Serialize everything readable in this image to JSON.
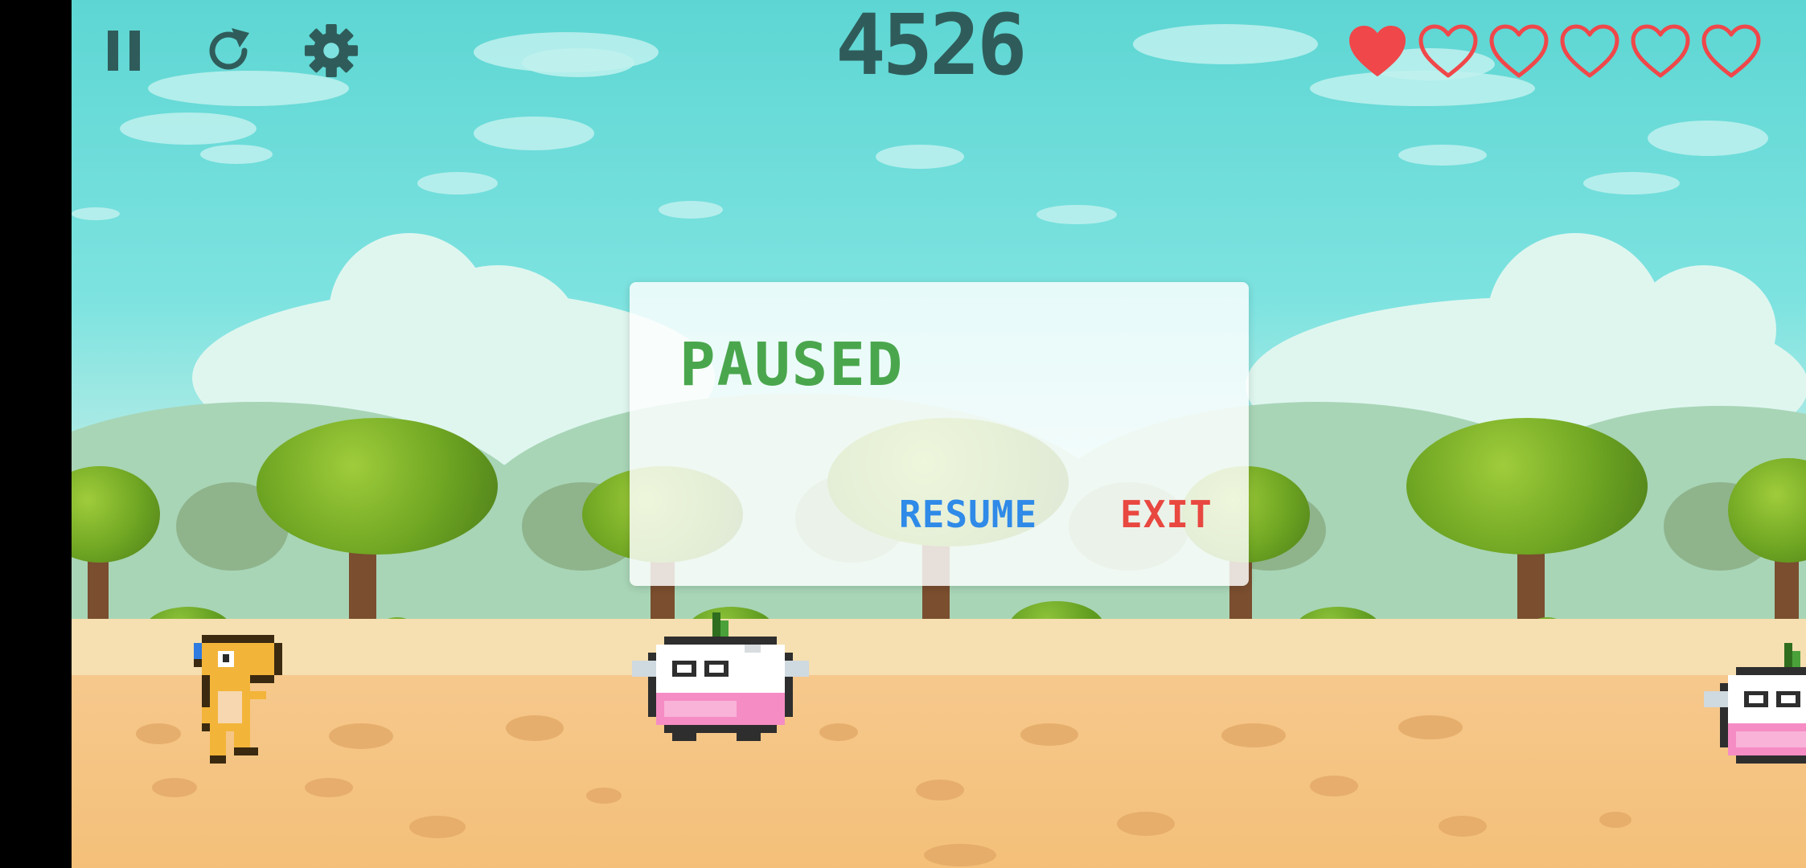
{
  "hud": {
    "score": "4526",
    "pause_icon": "pause-icon",
    "restart_icon": "restart-icon",
    "settings_icon": "gear-icon",
    "lives": {
      "filled": 1,
      "total": 6
    },
    "heart_color": "#f0474a"
  },
  "pause_dialog": {
    "title": "PAUSED",
    "resume_label": "RESUME",
    "exit_label": "EXIT",
    "title_color": "#4aa64d",
    "resume_color": "#2f8ae8",
    "exit_color": "#e84840"
  },
  "sprites": {
    "player": "dinosaur-player",
    "enemies": [
      "turnip-enemy",
      "turnip-enemy"
    ]
  }
}
